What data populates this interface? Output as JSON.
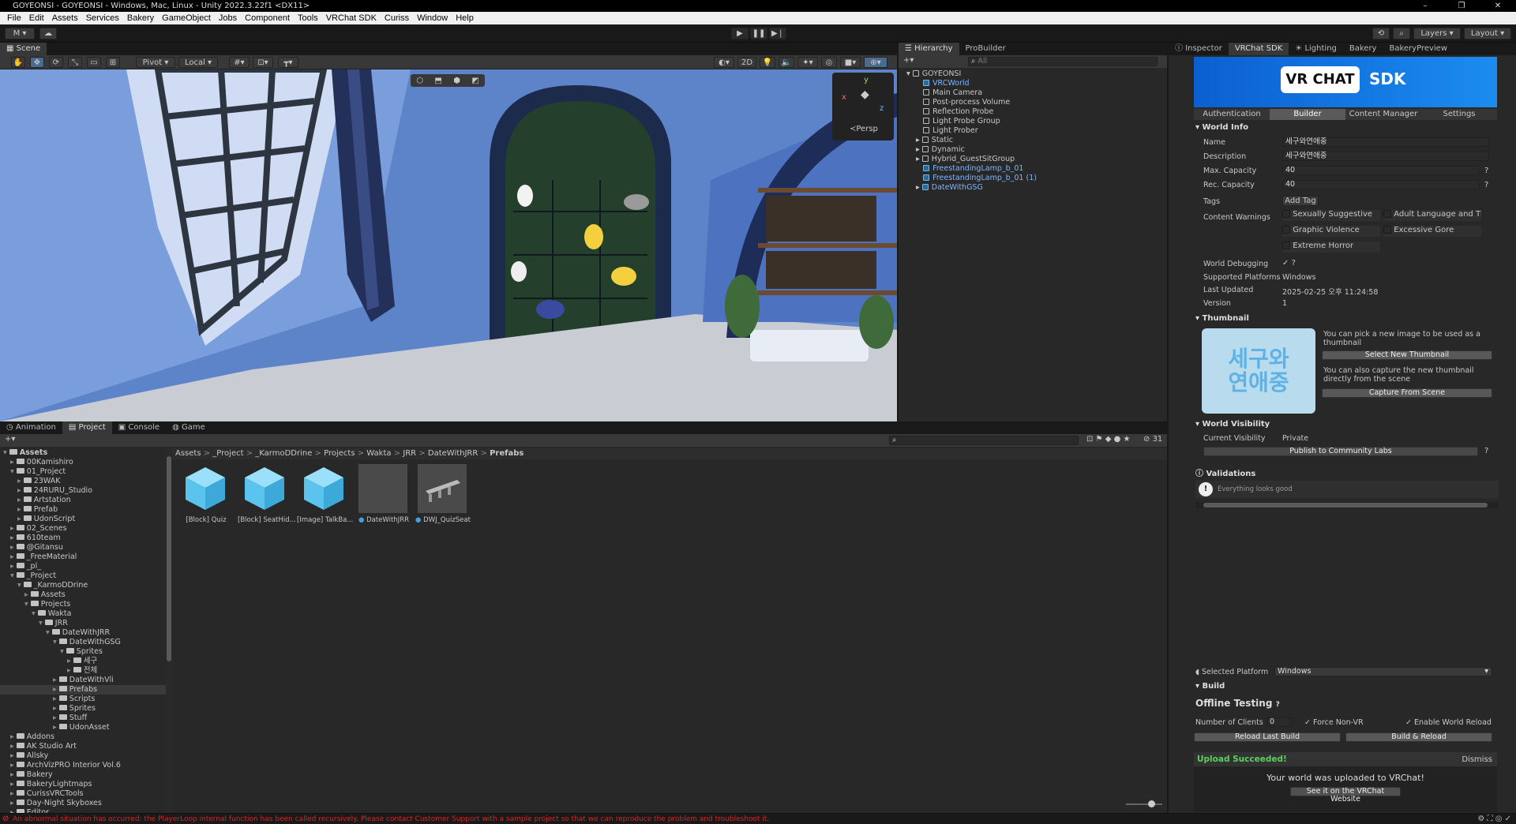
{
  "window": {
    "title": "GOYEONSI - GOYEONSI - Windows, Mac, Linux - Unity 2022.3.22f1 <DX11>",
    "controls": [
      "–",
      "❐",
      "✕"
    ]
  },
  "menu": [
    "File",
    "Edit",
    "Assets",
    "Services",
    "Bakery",
    "GameObject",
    "Jobs",
    "Component",
    "Tools",
    "VRChat SDK",
    "Curiss",
    "Window",
    "Help"
  ],
  "toolbar": {
    "account": "M ▾",
    "layers": "Layers",
    "layout": "Layout"
  },
  "scene": {
    "tab": "Scene",
    "pivot": "Pivot",
    "local": "Local",
    "mode2d": "2D",
    "persp": "≺Persp",
    "gizmo_y": "y",
    "gizmo_x": "x",
    "gizmo_z": "z"
  },
  "hierarchy": {
    "tabs": [
      "Hierarchy",
      "ProBuilder"
    ],
    "search_placeholder": "All",
    "root": "GOYEONSI",
    "items": [
      {
        "label": "VRCWorld",
        "blue": true,
        "indent": 1
      },
      {
        "label": "Main Camera",
        "blue": false,
        "indent": 1
      },
      {
        "label": "Post-process Volume",
        "blue": false,
        "indent": 1
      },
      {
        "label": "Reflection Probe",
        "blue": false,
        "indent": 1
      },
      {
        "label": "Light Probe Group",
        "blue": false,
        "indent": 1
      },
      {
        "label": "Light Prober",
        "blue": false,
        "indent": 1
      },
      {
        "label": "Static",
        "blue": false,
        "indent": 1,
        "arrow": true
      },
      {
        "label": "Dynamic",
        "blue": false,
        "indent": 1,
        "arrow": true
      },
      {
        "label": "Hybrid_GuestSitGroup",
        "blue": false,
        "indent": 1,
        "arrow": true
      },
      {
        "label": "FreestandingLamp_b_01",
        "blue": true,
        "indent": 1
      },
      {
        "label": "FreestandingLamp_b_01 (1)",
        "blue": true,
        "indent": 1
      },
      {
        "label": "DateWithGSG",
        "blue": true,
        "indent": 1,
        "arrow": true
      }
    ]
  },
  "inspector": {
    "tabs": [
      "Inspector",
      "VRChat SDK",
      "Lighting",
      "Bakery",
      "BakeryPreview"
    ],
    "banner_left": "VR CHAT",
    "banner_right": "SDK",
    "subtabs": [
      "Authentication",
      "Builder",
      "Content Manager",
      "Settings"
    ],
    "world_info_title": "World Info",
    "name_label": "Name",
    "name_value": "세구와연애중",
    "desc_label": "Description",
    "desc_value": "세구와연애중",
    "maxcap_label": "Max. Capacity",
    "maxcap_value": "40",
    "reccap_label": "Rec. Capacity",
    "reccap_value": "40",
    "tags_label": "Tags",
    "add_tag": "Add Tag",
    "content_warnings_label": "Content Warnings",
    "warnings": [
      "Sexually Suggestive",
      "Adult Language and Then",
      "Graphic Violence",
      "Excessive Gore",
      "Extreme Horror"
    ],
    "debug_label": "World Debugging",
    "platforms_label": "Supported Platforms",
    "platforms_value": "Windows",
    "updated_label": "Last Updated",
    "updated_value": "2025-02-25 오후 11:24:58",
    "version_label": "Version",
    "version_value": "1",
    "thumbnail_title": "Thumbnail",
    "thumb_text1": "You can pick a new image to be used as a thumbnail",
    "select_thumb": "Select New Thumbnail",
    "thumb_text2": "You can also capture the new thumbnail directly from the scene",
    "capture": "Capture From Scene",
    "thumb_art": "세구와 연애중",
    "visibility_title": "World Visibility",
    "visibility_label": "Current Visibility",
    "visibility_value": "Private",
    "publish": "Publish to Community Labs",
    "validations_title": "Validations",
    "validation_msg": "Everything looks good",
    "platform_label": "Selected Platform",
    "platform_value": "Windows",
    "build_title": "Build",
    "offline_title": "Offline Testing",
    "clients_label": "Number of Clients",
    "clients_value": "0",
    "force_nonvr": "Force Non-VR",
    "enable_reload": "Enable World Reload",
    "reload_last": "Reload Last Build",
    "build_reload": "Build & Reload",
    "upload_status": "Upload Succeeded!",
    "dismiss": "Dismiss",
    "upload_msg": "Your world was uploaded to VRChat!",
    "see_website": "See it on the VRChat Website"
  },
  "bottom": {
    "tabs": [
      "Animation",
      "Project",
      "Console",
      "Game"
    ],
    "breadcrumb": [
      "Assets",
      "_Project",
      "_KarmoDDrine",
      "Projects",
      "Wakta",
      "JRR",
      "DateWithJRR",
      "Prefabs"
    ],
    "count": "31",
    "tree": [
      {
        "label": "Assets",
        "indent": 0,
        "open": true,
        "bold": true
      },
      {
        "label": "00Kamishiro",
        "indent": 1
      },
      {
        "label": "01_Project",
        "indent": 1,
        "open": true
      },
      {
        "label": "23WAK",
        "indent": 2
      },
      {
        "label": "24RURU_Studio",
        "indent": 2
      },
      {
        "label": "Artstation",
        "indent": 2
      },
      {
        "label": "Prefab",
        "indent": 2
      },
      {
        "label": "UdonScript",
        "indent": 2
      },
      {
        "label": "02_Scenes",
        "indent": 1
      },
      {
        "label": "610team",
        "indent": 1
      },
      {
        "label": "@Gitansu",
        "indent": 1
      },
      {
        "label": "_FreeMaterial",
        "indent": 1
      },
      {
        "label": "_pl_",
        "indent": 1
      },
      {
        "label": "_Project",
        "indent": 1,
        "open": true
      },
      {
        "label": "_KarmoDDrine",
        "indent": 2,
        "open": true
      },
      {
        "label": "Assets",
        "indent": 3
      },
      {
        "label": "Projects",
        "indent": 3,
        "open": true
      },
      {
        "label": "Wakta",
        "indent": 4,
        "open": true
      },
      {
        "label": "JRR",
        "indent": 5,
        "open": true
      },
      {
        "label": "DateWithJRR",
        "indent": 6,
        "open": true
      },
      {
        "label": "DateWithGSG",
        "indent": 7,
        "open": true
      },
      {
        "label": "Sprites",
        "indent": 8,
        "open": true
      },
      {
        "label": "세구",
        "indent": 9
      },
      {
        "label": "전체",
        "indent": 9
      },
      {
        "label": "DateWithVli",
        "indent": 7
      },
      {
        "label": "Prefabs",
        "indent": 7,
        "selected": true
      },
      {
        "label": "Scripts",
        "indent": 7
      },
      {
        "label": "Sprites",
        "indent": 7
      },
      {
        "label": "Stuff",
        "indent": 7
      },
      {
        "label": "UdonAsset",
        "indent": 7
      },
      {
        "label": "Addons",
        "indent": 1
      },
      {
        "label": "AK Studio Art",
        "indent": 1
      },
      {
        "label": "Allsky",
        "indent": 1
      },
      {
        "label": "ArchVizPRO Interior Vol.6",
        "indent": 1
      },
      {
        "label": "Bakery",
        "indent": 1
      },
      {
        "label": "BakeryLightmaps",
        "indent": 1
      },
      {
        "label": "CurissVRCTools",
        "indent": 1
      },
      {
        "label": "Day-Night Skyboxes",
        "indent": 1
      },
      {
        "label": "Editor",
        "indent": 1
      }
    ],
    "assets": [
      {
        "label": "[Block] Quiz",
        "kind": "cube"
      },
      {
        "label": "[Block] SeatHid...",
        "kind": "cube"
      },
      {
        "label": "[Image] TalkBa...",
        "kind": "cube"
      },
      {
        "label": "DateWithJRR",
        "kind": "gray",
        "vrc": true
      },
      {
        "label": "DWJ_QuizSeat",
        "kind": "seat",
        "vrc": true
      }
    ]
  },
  "status": {
    "error": "An abnormal situation has occurred: the PlayerLoop internal function has been called recursively. Please contact Customer Support with a sample project so that we can reproduce the problem and troubleshoot it."
  }
}
